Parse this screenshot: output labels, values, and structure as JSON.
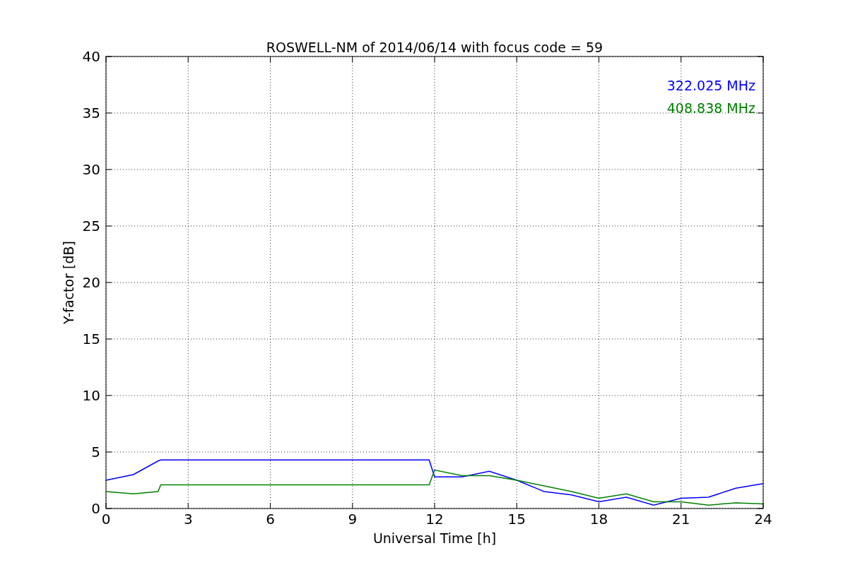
{
  "figure": {
    "chart_data": {
      "type": "line",
      "title": "ROSWELL-NM of 2014/06/14 with focus code = 59",
      "xlabel": "Universal Time [h]",
      "ylabel": "Y-factor [dB]",
      "x": [
        0,
        1,
        1.9,
        2,
        11.8,
        12,
        13,
        14,
        15,
        16,
        17,
        18,
        19,
        20,
        21,
        22,
        23,
        24
      ],
      "series": [
        {
          "name": "322.025 MHz",
          "color": "#0000ff",
          "values": [
            2.5,
            3,
            4.2,
            4.3,
            4.3,
            2.8,
            2.8,
            3.3,
            2.5,
            1.5,
            1.2,
            0.6,
            1,
            0.3,
            0.9,
            1,
            1.8,
            2.2
          ]
        },
        {
          "name": "408.838 MHz",
          "color": "#008000",
          "values": [
            1.5,
            1.3,
            1.5,
            2.1,
            2.1,
            3.4,
            2.9,
            2.9,
            2.5,
            2,
            1.5,
            0.9,
            1.3,
            0.6,
            0.6,
            0.3,
            0.5,
            0.4
          ]
        }
      ],
      "xlim": [
        0,
        24
      ],
      "ylim": [
        0,
        40
      ],
      "xticks": [
        0,
        3,
        6,
        9,
        12,
        15,
        18,
        21,
        24
      ],
      "yticks": [
        0,
        5,
        10,
        15,
        20,
        25,
        30,
        35,
        40
      ],
      "grid": true
    }
  }
}
